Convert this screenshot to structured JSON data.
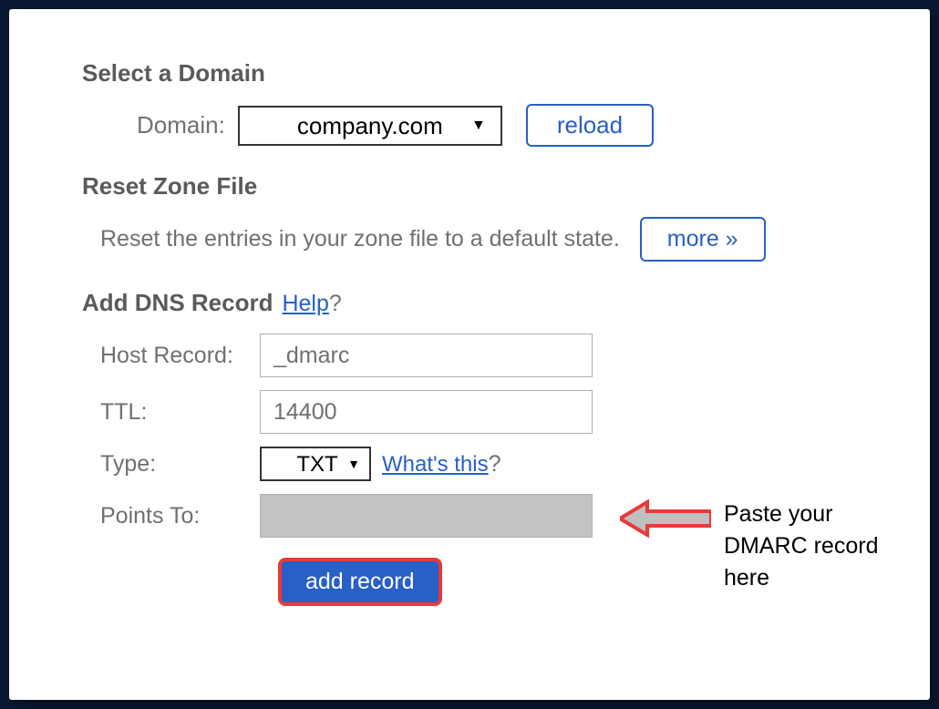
{
  "select_domain": {
    "heading": "Select a Domain",
    "label": "Domain:",
    "value": "company.com",
    "reload_label": "reload"
  },
  "reset_zone": {
    "heading": "Reset Zone File",
    "text": "Reset the entries in your zone file to a default state.",
    "more_label": "more »"
  },
  "add_dns": {
    "heading": "Add DNS Record",
    "help_label": "Help",
    "help_q": "?",
    "fields": {
      "host_record": {
        "label": "Host Record:",
        "value": "_dmarc"
      },
      "ttl": {
        "label": "TTL:",
        "value": "14400"
      },
      "type": {
        "label": "Type:",
        "value": "TXT",
        "whats_this": "What's this",
        "whats_q": "?"
      },
      "points_to": {
        "label": "Points To:",
        "value": ""
      }
    },
    "add_record_label": "add record"
  },
  "annotation": {
    "text": "Paste your DMARC record here"
  }
}
